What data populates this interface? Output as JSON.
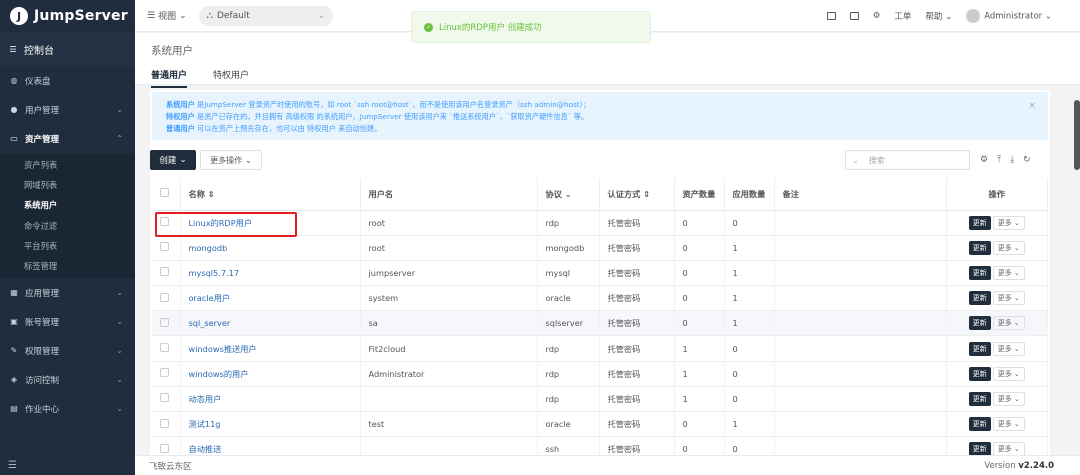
{
  "brand": {
    "name": "JumpServer",
    "logo_letter": "J"
  },
  "sidebar": {
    "console": "控制台",
    "items": [
      {
        "label": "仪表盘",
        "icon": "dashboard-icon"
      },
      {
        "label": "用户管理",
        "icon": "users-icon"
      },
      {
        "label": "资产管理",
        "icon": "assets-icon"
      },
      {
        "label": "应用管理",
        "icon": "apps-icon"
      },
      {
        "label": "账号管理",
        "icon": "account-icon"
      },
      {
        "label": "权限管理",
        "icon": "permission-icon"
      },
      {
        "label": "访问控制",
        "icon": "access-icon"
      },
      {
        "label": "作业中心",
        "icon": "jobs-icon"
      }
    ],
    "sub_items": [
      "资产列表",
      "网域列表",
      "系统用户",
      "命令过滤",
      "平台列表",
      "标签管理"
    ]
  },
  "topbar": {
    "view": "视图",
    "org": "Default",
    "workorder": "工单",
    "help": "帮助",
    "user": "Administrator"
  },
  "toast": {
    "message": "Linux的RDP用户 创建成功"
  },
  "page": {
    "title": "系统用户",
    "tabs": [
      "普通用户",
      "特权用户"
    ],
    "alert": {
      "l1_b": "系统用户",
      "l1": " 是JumpServer 登录资产时使用的账号，如 root `ssh root@host`，而不是使用该用户名登录资产（ssh admin@host）；",
      "l2_b": "特权用户",
      "l2": " 是资产已存在的，并且拥有 高级权限 的系统用户，JumpServer 使用该用户来 `推送系统用户`、`获取资产硬件信息` 等。",
      "l3_b": "普通用户",
      "l3": " 可以在资产上预先存在，也可以由 特权用户 来自动创建。"
    },
    "create": "创建",
    "more_actions": "更多操作",
    "search_placeholder": "搜索"
  },
  "table": {
    "headers": [
      "名称",
      "用户名",
      "协议",
      "认证方式",
      "资产数量",
      "应用数量",
      "备注",
      "操作"
    ],
    "update_label": "更新",
    "more_label": "更多",
    "rows": [
      {
        "name": "Linux的RDP用户",
        "username": "root",
        "protocol": "rdp",
        "auth": "托管密码",
        "assets": "0",
        "apps": "0"
      },
      {
        "name": "mongodb",
        "username": "root",
        "protocol": "mongodb",
        "auth": "托管密码",
        "assets": "0",
        "apps": "1"
      },
      {
        "name": "mysql5.7.17",
        "username": "jumpserver",
        "protocol": "mysql",
        "auth": "托管密码",
        "assets": "0",
        "apps": "1"
      },
      {
        "name": "oracle用户",
        "username": "system",
        "protocol": "oracle",
        "auth": "托管密码",
        "assets": "0",
        "apps": "1"
      },
      {
        "name": "sql_server",
        "username": "sa",
        "protocol": "sqlserver",
        "auth": "托管密码",
        "assets": "0",
        "apps": "1"
      },
      {
        "name": "windows推送用户",
        "username": "Fit2cloud",
        "protocol": "rdp",
        "auth": "托管密码",
        "assets": "1",
        "apps": "0"
      },
      {
        "name": "windows的用户",
        "username": "Administrator",
        "protocol": "rdp",
        "auth": "托管密码",
        "assets": "1",
        "apps": "0"
      },
      {
        "name": "动态用户",
        "username": "",
        "protocol": "rdp",
        "auth": "托管密码",
        "assets": "1",
        "apps": "0"
      },
      {
        "name": "测试11g",
        "username": "test",
        "protocol": "oracle",
        "auth": "托管密码",
        "assets": "0",
        "apps": "1"
      },
      {
        "name": "自动推送",
        "username": "",
        "protocol": "ssh",
        "auth": "托管密码",
        "assets": "0",
        "apps": "0"
      }
    ]
  },
  "footer": {
    "left": "飞致云东区",
    "version_label": "Version",
    "version": "v2.24.0"
  }
}
